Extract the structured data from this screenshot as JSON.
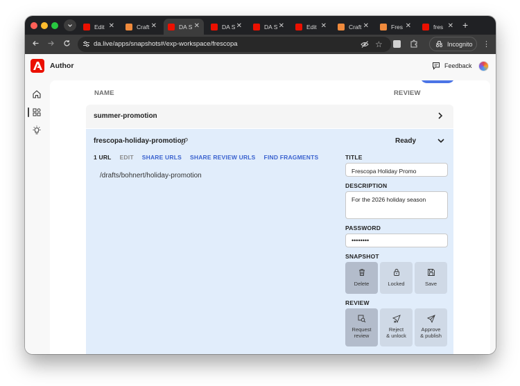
{
  "browser": {
    "tabs": [
      {
        "title": "Edit",
        "favicon": "adobe",
        "active": false
      },
      {
        "title": "Craft",
        "favicon": "craft",
        "active": false
      },
      {
        "title": "DA S",
        "favicon": "adobe",
        "active": true
      },
      {
        "title": "DA S",
        "favicon": "adobe",
        "active": false
      },
      {
        "title": "DA S",
        "favicon": "adobe",
        "active": false
      },
      {
        "title": "Edit",
        "favicon": "adobe",
        "active": false
      },
      {
        "title": "Craft",
        "favicon": "craft",
        "active": false
      },
      {
        "title": "Fres",
        "favicon": "craft",
        "active": false
      },
      {
        "title": "fres",
        "favicon": "adobe",
        "active": false
      }
    ],
    "url": "da.live/apps/snapshots#/exp-workspace/frescopa",
    "incognito_label": "Incognito",
    "colors": {
      "frame": "#202124",
      "toolbar": "#3c3c3c",
      "adobe_red": "#eb1000"
    }
  },
  "app": {
    "name": "Author",
    "feedback_label": "Feedback",
    "sidebar_icons": [
      "home-icon",
      "apps-icon",
      "lightbulb-icon"
    ]
  },
  "table": {
    "col_name": "NAME",
    "col_review": "REVIEW",
    "rows": [
      {
        "name": "summer-promotion"
      }
    ]
  },
  "snapshot": {
    "name": "frescopa-holiday-promotion",
    "status": "Ready",
    "tabs": [
      {
        "label": "1 URL",
        "style": "cur"
      },
      {
        "label": "EDIT",
        "style": "muted"
      },
      {
        "label": "SHARE URLS",
        "style": "link"
      },
      {
        "label": "SHARE REVIEW URLS",
        "style": "link"
      },
      {
        "label": "FIND FRAGMENTS",
        "style": "link"
      }
    ],
    "path": "/drafts/bohnert/holiday-promotion",
    "title_label": "TITLE",
    "title_value": "Frescopa Holiday Promo",
    "description_label": "DESCRIPTION",
    "description_value": "For the 2026 holiday season",
    "password_label": "PASSWORD",
    "password_value": "••••••••",
    "snapshot_label": "SNAPSHOT",
    "snapshot_actions": [
      {
        "label": "Delete",
        "icon": "trash-icon"
      },
      {
        "label": "Locked",
        "icon": "lock-icon"
      },
      {
        "label": "Save",
        "icon": "save-icon"
      }
    ],
    "review_label": "REVIEW",
    "review_actions": [
      {
        "label": "Request review",
        "icon": "request-review-icon"
      },
      {
        "label": "Reject & unlock",
        "icon": "reject-icon"
      },
      {
        "label": "Approve & publish",
        "icon": "send-icon"
      }
    ],
    "colors": {
      "expanded_bg": "#e1edfb",
      "link": "#3b63cf"
    }
  }
}
